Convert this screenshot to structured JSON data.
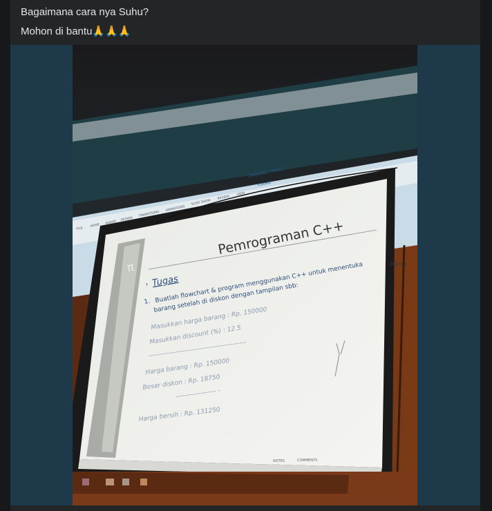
{
  "post": {
    "line1": "Bagaimana cara nya Suhu?",
    "line2_text": "Mohon di bantu",
    "line2_emoji": "🙏🙏🙏"
  },
  "slide": {
    "title": "Pemrograman C++",
    "section": "Tugas",
    "bullet_marker": "›",
    "task_number": "1.",
    "task_line1": "Buatlah flowchart & program menggunakan C++ untuk menentuka",
    "task_line2": "barang setelah di diskon dengan tampilan sbb:",
    "input1": "Masukkan harga barang : Rp. 150000",
    "input2": "Masukkan discount (%) : 12.5",
    "separator1": "--------------------------------------------",
    "out1": "Harga barang : Rp. 150000",
    "out2": "Besar diskon : Rp. 18750",
    "separator2": "------------------ -",
    "out3": "Harga bersih : Rp. 131250",
    "logo_symbol": "π"
  },
  "ribbon": {
    "drawing_tools": "DRAWING TOOLS",
    "format": "FORMAT",
    "tabs": [
      "FILE",
      "HOME",
      "INSERT",
      "DESIGN",
      "TRANSITIONS",
      "ANIMATIONS",
      "SLIDE SHOW",
      "REVIEW",
      "VIEW"
    ]
  },
  "statusbar": {
    "notes": "NOTES",
    "comments": "COMMENTS"
  },
  "wall_label": "Harga",
  "colors": {
    "post_bg": "#242526",
    "page_bg": "#17181a",
    "text": "#e4e6eb",
    "media_bg": "#1e3a4a"
  }
}
